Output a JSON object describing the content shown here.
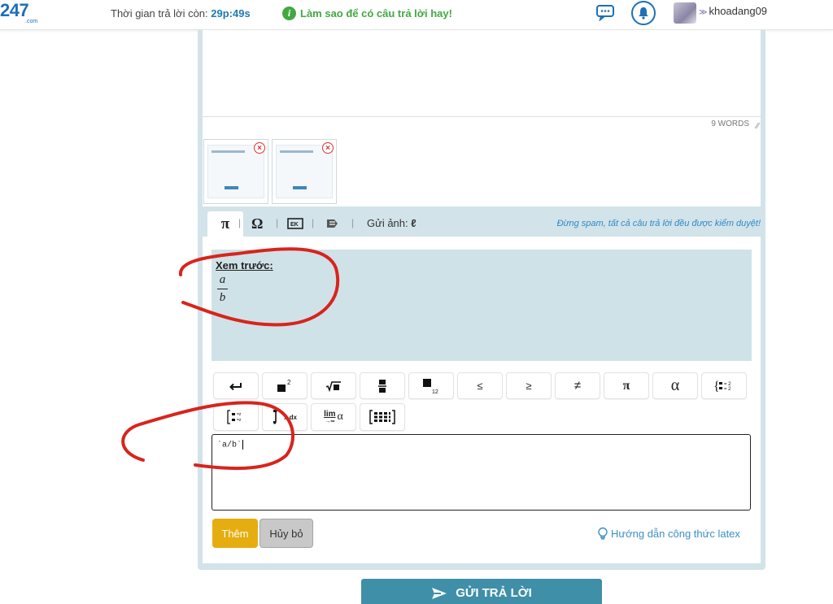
{
  "header": {
    "logo_number": "247",
    "logo_suffix": ".com",
    "timer_label": "Thời gian trả lời còn:",
    "timer_value": "29p:49s",
    "howto_label": "Làm sao để có câu trả lời hay!",
    "username": "khoadang09"
  },
  "editor": {
    "word_count": "9 WORDS",
    "thumbnail_remove_symbol": "×"
  },
  "toolbar": {
    "pi_symbol": "π",
    "omega_symbol": "Ω",
    "separator": "|",
    "send_image_label": "Gửi ảnh:",
    "antispam_notice": "Đừng spam, tất cả câu trả lời đều được kiểm duyệt!"
  },
  "math": {
    "preview_title": "Xem trước:",
    "preview_numerator": "a",
    "preview_denominator": "b",
    "input_value": "`a/b`",
    "buttons": {
      "leq": "≤",
      "geq": "≥",
      "neq": "≠",
      "pi": "π",
      "alpha": "α",
      "integral_dx": "x dx",
      "lim": "lim",
      "lim_sub": "→∞",
      "lim_var": "α"
    }
  },
  "actions": {
    "add_label": "Thêm",
    "cancel_label": "Hủy bỏ",
    "latex_guide_label": "Hướng dẫn công thức latex",
    "submit_label": "GỬI TRẢ LỜI"
  },
  "colors": {
    "brand_blue": "#1f6fb5",
    "green": "#43a843",
    "panel_bg": "#d2e3ea",
    "add_button": "#e5ad0f",
    "submit_button": "#3f8fa8",
    "annotation_red": "#d8241c"
  }
}
